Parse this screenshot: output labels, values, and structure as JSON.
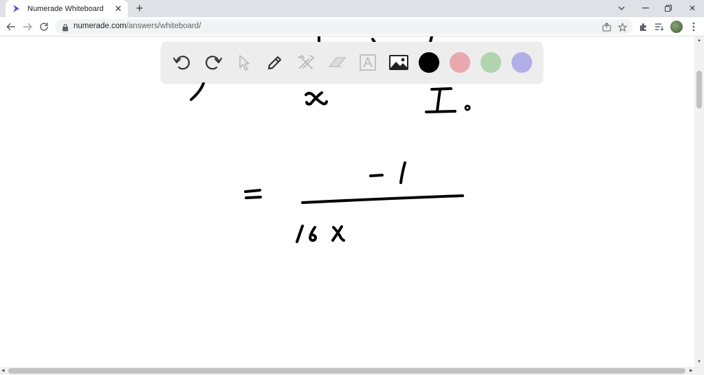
{
  "browser": {
    "tab_title": "Numerade Whiteboard",
    "url_host": "numerade.com",
    "url_path": "/answers/whiteboard/"
  },
  "whiteboard_toolbar": {
    "tools": [
      "undo-icon",
      "redo-icon",
      "select-pointer-icon",
      "pen-icon",
      "tools-icon",
      "eraser-icon",
      "text-icon",
      "image-icon"
    ],
    "colors": [
      "#000000",
      "#e8a8ae",
      "#b0d4ae",
      "#b2aee8"
    ],
    "selected_color": "#000000"
  },
  "accent_color": "#1a73e8"
}
